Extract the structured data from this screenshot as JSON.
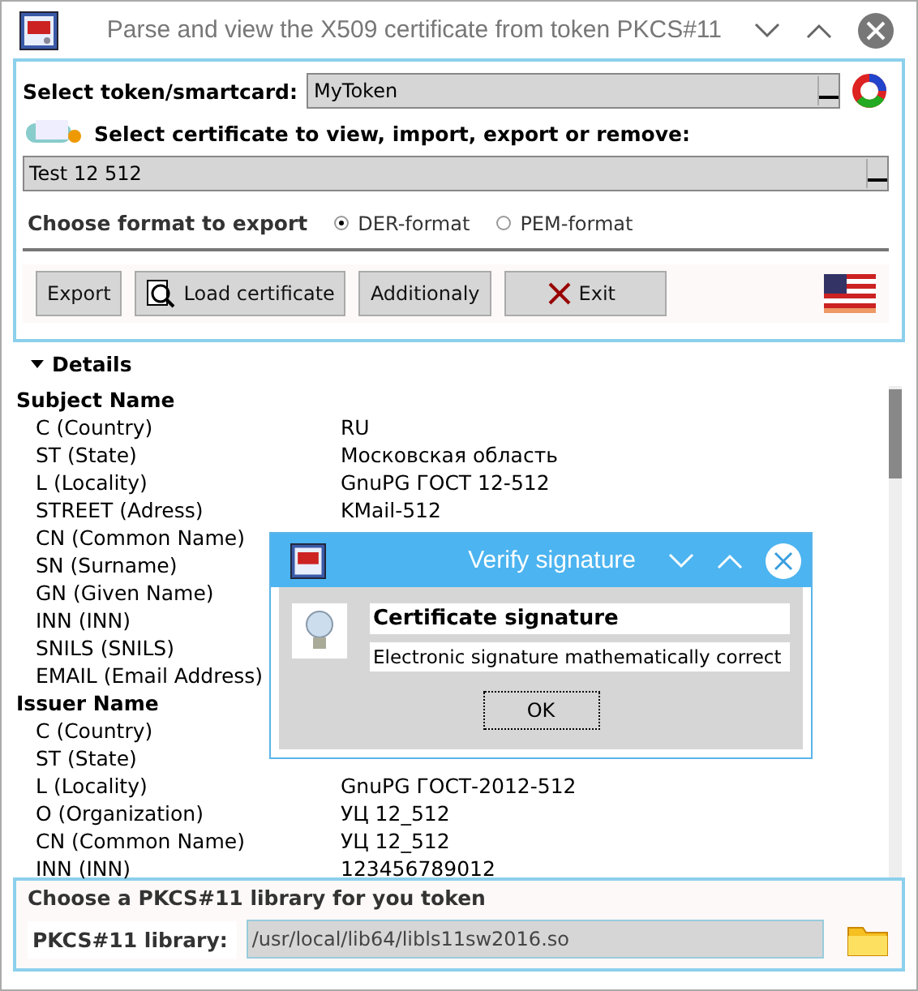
{
  "window": {
    "title": "Parse and view the X509 certificate from token PKCS#11"
  },
  "token": {
    "label": "Select token/smartcard:",
    "value": "MyToken"
  },
  "certificate": {
    "label": "Select certificate to view, import, export or remove:",
    "value": "Test 12 512"
  },
  "format": {
    "label": "Choose format to export",
    "options": [
      {
        "label": "DER-format",
        "selected": true
      },
      {
        "label": "PEM-format",
        "selected": false
      }
    ]
  },
  "buttons": [
    {
      "label": "Export",
      "kind": "plain"
    },
    {
      "label": "Load certificate",
      "kind": "load"
    },
    {
      "label": "Additionaly",
      "kind": "plain"
    },
    {
      "label": "Exit",
      "kind": "exit"
    }
  ],
  "details": {
    "title": "Details",
    "expanded": true,
    "sections": [
      {
        "title": "Subject Name",
        "rows": [
          {
            "name": "C (Country)",
            "value": "RU"
          },
          {
            "name": "ST (State)",
            "value": "Московская область"
          },
          {
            "name": "L (Locality)",
            "value": "GnuPG ГОСТ 12-512"
          },
          {
            "name": "STREET (Adress)",
            "value": "KMail-512"
          },
          {
            "name": "CN (Common Name)"
          },
          {
            "name": "SN (Surname)"
          },
          {
            "name": "GN (Given Name)"
          },
          {
            "name": "INN (INN)"
          },
          {
            "name": "SNILS (SNILS)"
          },
          {
            "name": "EMAIL (Email Address)"
          }
        ]
      },
      {
        "title": "Issuer Name",
        "rows": [
          {
            "name": "C (Country)"
          },
          {
            "name": "ST (State)"
          },
          {
            "name": "L (Locality)",
            "value": "GnuPG ГОСТ-2012-512"
          },
          {
            "name": "O (Organization)",
            "value": "УЦ 12_512"
          },
          {
            "name": "CN (Common Name)",
            "value": "УЦ 12_512"
          },
          {
            "name": "INN (INN)",
            "value": "123456789012"
          }
        ]
      }
    ]
  },
  "library": {
    "title": "Choose a PKCS#11 library for you token",
    "label": "PKCS#11 library:",
    "value": "/usr/local/lib64/libls11sw2016.so"
  },
  "dialog": {
    "title": "Verify signature",
    "heading": "Certificate signature",
    "message": "Electronic signature mathematically correct",
    "button": "OK"
  }
}
